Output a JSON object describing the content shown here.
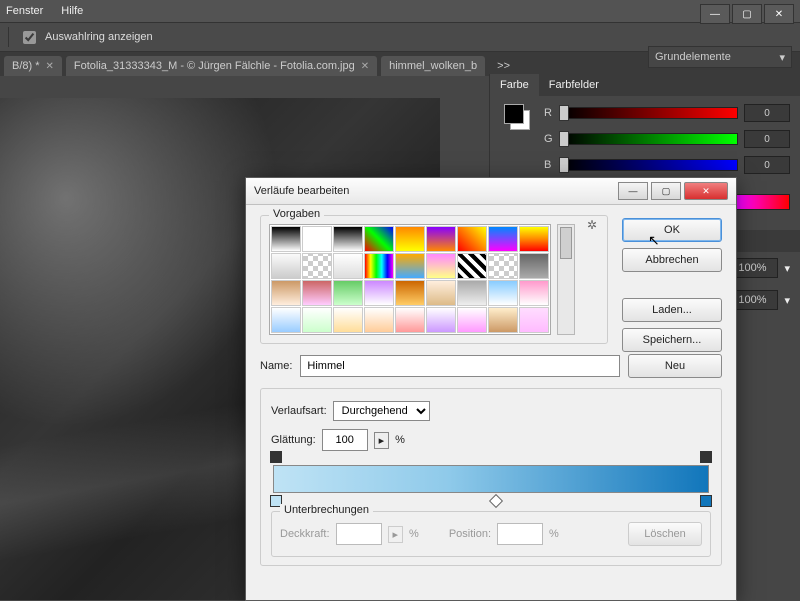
{
  "menu": {
    "fenster": "Fenster",
    "hilfe": "Hilfe"
  },
  "optionbar": {
    "auswahl": "Auswahlring anzeigen"
  },
  "preset_dropdown": "Grundelemente",
  "tabs": {
    "t1": "B/8) *",
    "t2": "Fotolia_31333343_M - © Jürgen Fälchle - Fotolia.com.jpg",
    "t3": "himmel_wolken_b",
    "more": ">>"
  },
  "color_panel": {
    "tab_farbe": "Farbe",
    "tab_farbfelder": "Farbfelder",
    "r": "R",
    "g": "G",
    "b": "B",
    "rval": "0",
    "gval": "0",
    "bval": "0"
  },
  "opacity": "100%",
  "dialog": {
    "title": "Verläufe bearbeiten",
    "presets_label": "Vorgaben",
    "ok": "OK",
    "cancel": "Abbrechen",
    "load": "Laden...",
    "save": "Speichern...",
    "name_label": "Name:",
    "name_value": "Himmel",
    "neu": "Neu",
    "type_label": "Verlaufsart:",
    "type_value": "Durchgehend",
    "smooth_label": "Glättung:",
    "smooth_value": "100",
    "pct": "%",
    "stops_label": "Unterbrechungen",
    "opacity_label": "Deckkraft:",
    "position_label": "Position:",
    "delete": "Löschen"
  }
}
